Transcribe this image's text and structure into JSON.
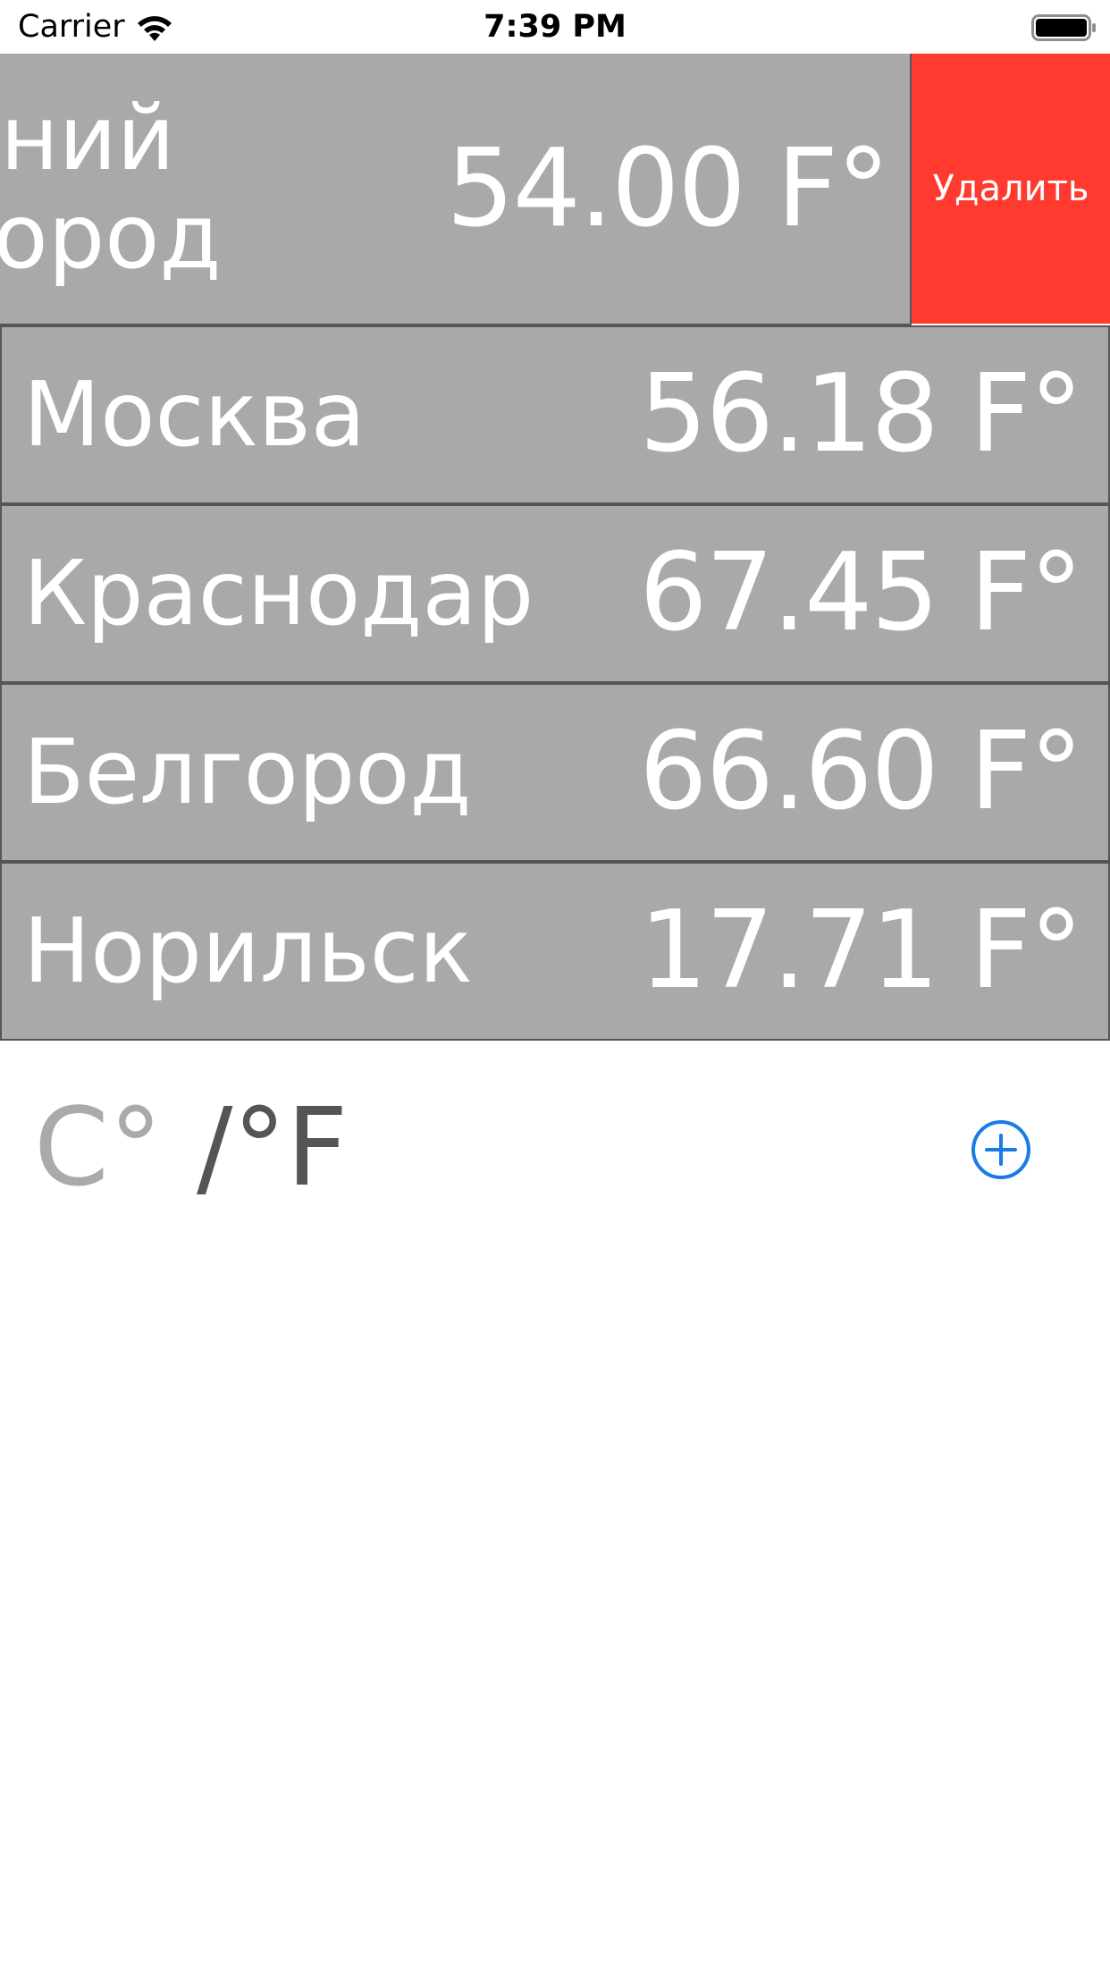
{
  "status_bar": {
    "carrier": "Carrier",
    "time": "7:39 PM",
    "wifi_icon": "wifi-icon",
    "battery_icon": "battery-full-icon"
  },
  "cities": [
    {
      "name": "кний\nгород",
      "temp": "54.00 F°",
      "swiped": true
    },
    {
      "name": "Москва",
      "temp": "56.18 F°"
    },
    {
      "name": "Краснодар",
      "temp": "67.45 F°"
    },
    {
      "name": "Белгород",
      "temp": "66.60 F°"
    },
    {
      "name": "Норильск",
      "temp": "17.71 F°"
    }
  ],
  "delete_label": "Удалить",
  "unit_toggle": {
    "celsius": "C°",
    "separator": " /",
    "fahrenheit": "°F"
  },
  "add_icon": "plus-circle-icon",
  "colors": {
    "row_background": "#a9a9a9",
    "row_border": "#555555",
    "delete": "#ff3b30",
    "accent": "#1a7ae6",
    "inactive_unit": "#aaaaaa",
    "active_unit": "#555555"
  }
}
